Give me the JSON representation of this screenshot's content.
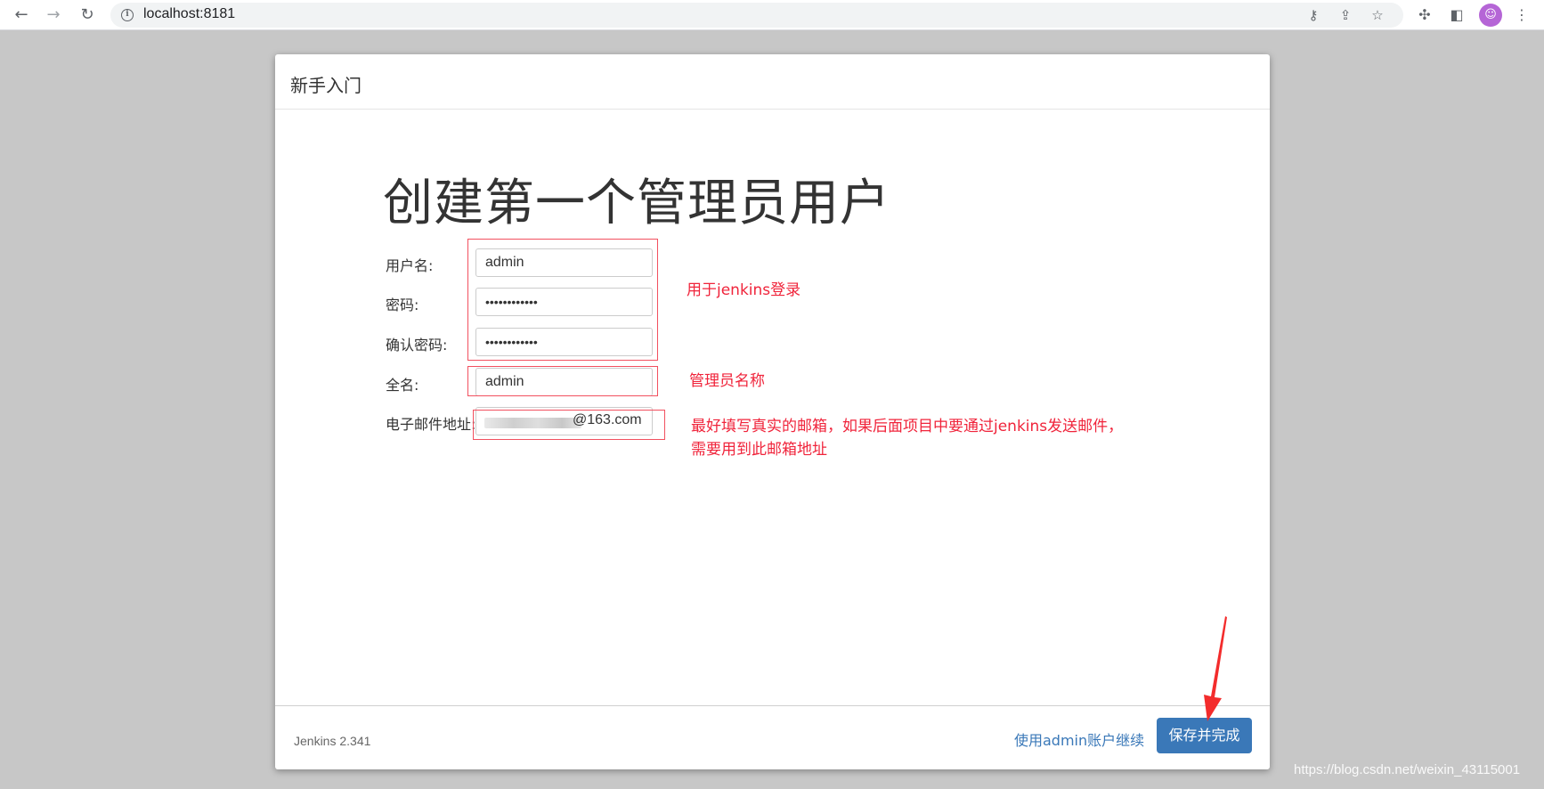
{
  "browser": {
    "url": "localhost:8181",
    "back_icon": "←",
    "forward_icon": "→",
    "reload_icon": "↻",
    "info_icon": "i",
    "key_icon": "⚷",
    "share_icon": "⇪",
    "star_icon": "☆",
    "extensions_icon": "✣",
    "sidepanel_icon": "◧",
    "avatar_glyph": "☺",
    "menu_icon": "⋮"
  },
  "dialog": {
    "header_title": "新手入门",
    "main_title": "创建第一个管理员用户",
    "fields": {
      "username": {
        "label": "用户名:",
        "value": "admin"
      },
      "password": {
        "label": "密码:",
        "value": "••••••••••••"
      },
      "confirm_password": {
        "label": "确认密码:",
        "value": "••••••••••••"
      },
      "fullname": {
        "label": "全名:",
        "value": "admin"
      },
      "email": {
        "label": "电子邮件地址:",
        "value_suffix": "@163.com"
      }
    },
    "footer": {
      "version": "Jenkins 2.341",
      "continue_link": "使用admin账户继续",
      "save_button": "保存并完成"
    }
  },
  "annotations": {
    "login_note": "用于jenkins登录",
    "fullname_note": "管理员名称",
    "email_note_line1": "最好填写真实的邮箱，如果后面项目中要通过jenkins发送邮件，",
    "email_note_line2": "需要用到此邮箱地址",
    "color": "#f0243b"
  },
  "watermark": "https://blog.csdn.net/weixin_43115001",
  "colors": {
    "primary": "#3a78b8",
    "background": "#c7c7c7"
  }
}
